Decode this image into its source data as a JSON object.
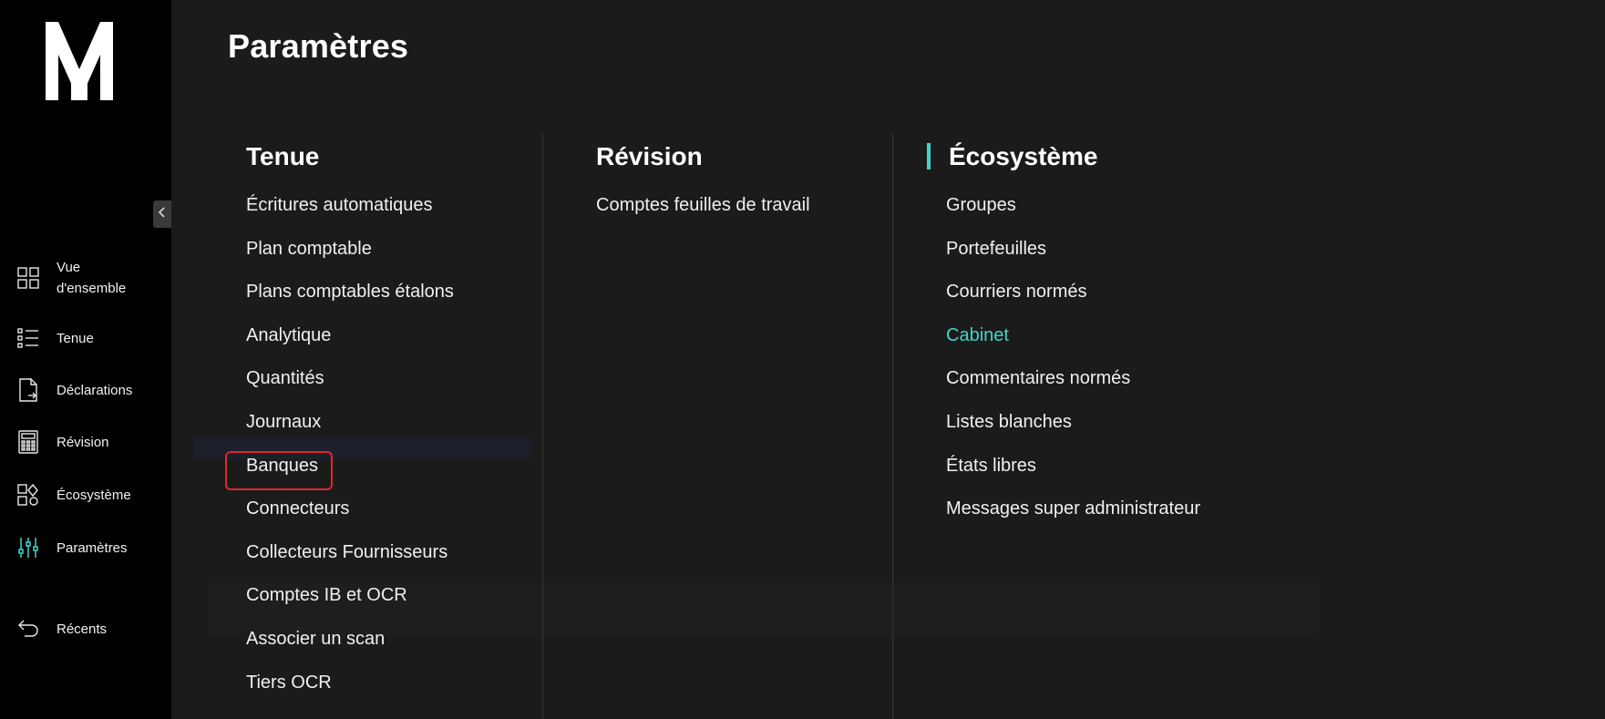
{
  "page": {
    "title": "Paramètres"
  },
  "colors": {
    "accent": "#3ed6cc",
    "highlight": "#e0262a",
    "sidebar_bg": "#000000",
    "content_bg": "#1b1b1b"
  },
  "sidebar": {
    "logo": "M",
    "collapse_icon": "chevron-left-icon",
    "items": [
      {
        "label": "Vue d'ensemble",
        "icon": "grid-icon"
      },
      {
        "label": "Tenue",
        "icon": "list-icon"
      },
      {
        "label": "Déclarations",
        "icon": "document-icon"
      },
      {
        "label": "Révision",
        "icon": "calculator-icon"
      },
      {
        "label": "Écosystème",
        "icon": "ecosystem-icon"
      },
      {
        "label": "Paramètres",
        "icon": "sliders-icon",
        "active": true
      },
      {
        "label": "Récents",
        "icon": "back-arrow-icon"
      }
    ]
  },
  "menu": {
    "tenue": {
      "heading": "Tenue",
      "items": [
        "Écritures automatiques",
        "Plan comptable",
        "Plans comptables étalons",
        "Analytique",
        "Quantités",
        "Journaux",
        "Banques",
        "Connecteurs",
        "Collecteurs Fournisseurs",
        "Comptes IB et OCR",
        "Associer un scan",
        "Tiers OCR"
      ],
      "highlighted": "Banques"
    },
    "revision": {
      "heading": "Révision",
      "items": [
        "Comptes feuilles de travail"
      ]
    },
    "ecosysteme": {
      "heading": "Écosystème",
      "items": [
        "Groupes",
        "Portefeuilles",
        "Courriers normés",
        "Cabinet",
        "Commentaires normés",
        "Listes blanches",
        "États libres",
        "Messages super administrateur"
      ],
      "active": "Cabinet"
    }
  }
}
